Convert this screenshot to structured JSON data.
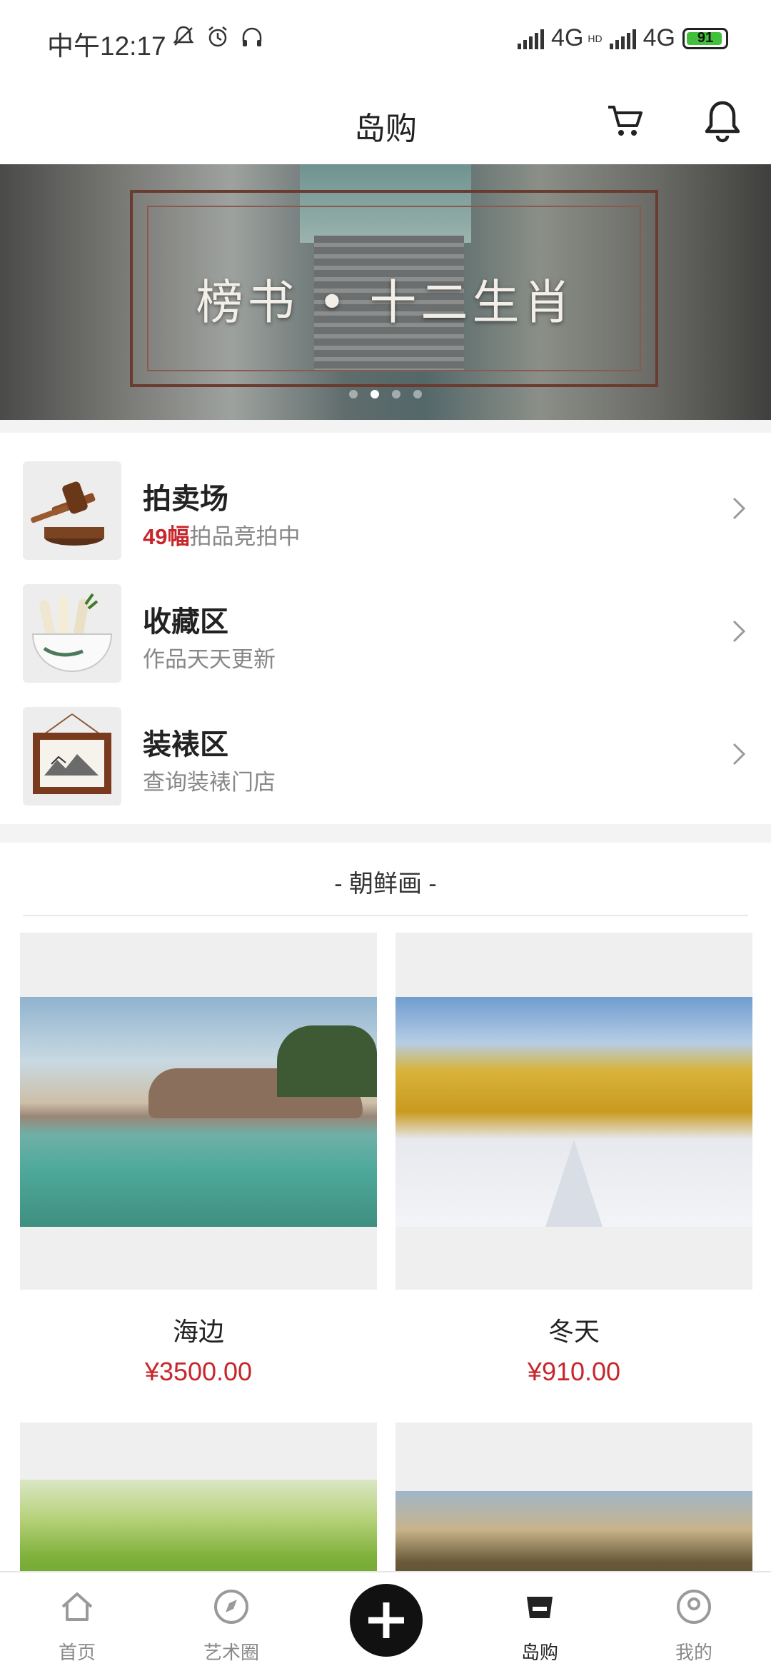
{
  "status_bar": {
    "time": "中午12:17",
    "icons": [
      "mute-bell-icon",
      "alarm-icon",
      "headphones-icon"
    ],
    "network_1": "4G",
    "network_2": "4G",
    "hd": "HD",
    "battery": "91"
  },
  "header": {
    "title": "岛购",
    "cart_icon": "cart-icon",
    "bell_icon": "bell-icon"
  },
  "banner": {
    "title": "榜书 • 十二生肖",
    "dots": 4,
    "active_dot": 1
  },
  "entries": [
    {
      "title": "拍卖场",
      "highlight": "49幅",
      "subtitle": "拍品竞拍中",
      "icon": "gavel-icon"
    },
    {
      "title": "收藏区",
      "highlight": "",
      "subtitle": "作品天天更新",
      "icon": "scroll-bowl-icon"
    },
    {
      "title": "装裱区",
      "highlight": "",
      "subtitle": "查询装裱门店",
      "icon": "framed-painting-icon"
    }
  ],
  "section": {
    "title": "- 朝鲜画 -"
  },
  "products": [
    {
      "name": "海边",
      "price": "¥3500.00"
    },
    {
      "name": "冬天",
      "price": "¥910.00"
    },
    {
      "name": "",
      "price": ""
    },
    {
      "name": "",
      "price": ""
    }
  ],
  "tabbar": {
    "items": [
      {
        "label": "首页",
        "icon": "home-icon"
      },
      {
        "label": "艺术圈",
        "icon": "compass-icon"
      },
      {
        "label": "",
        "icon": "plus-icon"
      },
      {
        "label": "岛购",
        "icon": "shop-icon"
      },
      {
        "label": "我的",
        "icon": "profile-icon"
      }
    ],
    "active": "岛购"
  }
}
